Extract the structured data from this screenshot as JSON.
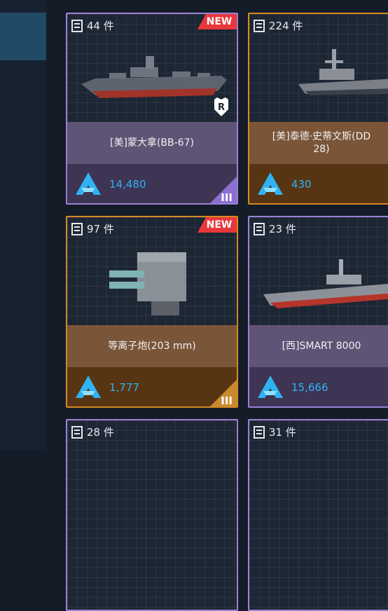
{
  "sidebar": {
    "active_tab_color": "#214a66"
  },
  "accent_colors": {
    "price_text": "#2fb3f2",
    "new_badge": "#e8383b",
    "rare_border": "#9b7fd6",
    "epic_border": "#d48a25"
  },
  "cards": [
    {
      "count": "44 件",
      "new": "NEW",
      "badge_icon": "r-shield-icon",
      "name": "[美]蒙大拿(BB-67)",
      "price": "14,480",
      "tier": "III",
      "rarity": "purple"
    },
    {
      "count": "224 件",
      "name_line1": "[美]泰德·史蒂文斯(DD",
      "name_line2": "28)",
      "price": "430",
      "rarity": "orange"
    },
    {
      "count": "97 件",
      "new": "NEW",
      "name": "等离子炮(203 mm)",
      "price": "1,777",
      "tier": "III",
      "rarity": "orange"
    },
    {
      "count": "23 件",
      "name": "[西]SMART 8000",
      "price": "15,666",
      "rarity": "purple"
    },
    {
      "count": "28 件",
      "rarity": "purple"
    },
    {
      "count": "31 件",
      "rarity": "purple"
    }
  ]
}
